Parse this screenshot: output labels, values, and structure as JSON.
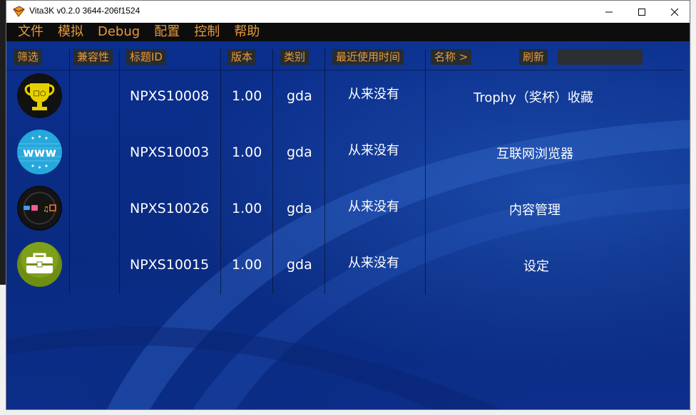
{
  "window": {
    "title": "Vita3K v0.2.0 3644-206f1524",
    "controls": {
      "minimize": "—",
      "maximize": "☐",
      "close": "✕"
    }
  },
  "menu": [
    "文件",
    "模拟",
    "Debug",
    "配置",
    "控制",
    "帮助"
  ],
  "header": {
    "filter": "筛选",
    "compat": "兼容性",
    "title_id": "标题ID",
    "version": "版本",
    "category": "类别",
    "last_used": "最近使用时间",
    "name": "名称 >",
    "refresh": "刷新",
    "search_value": ""
  },
  "apps": [
    {
      "icon": "trophy-icon",
      "title_id": "NPXS10008",
      "version": "1.00",
      "category": "gda",
      "last_used": "从来没有",
      "name": "Trophy（奖杯）收藏"
    },
    {
      "icon": "www-icon",
      "title_id": "NPXS10003",
      "version": "1.00",
      "category": "gda",
      "last_used": "从来没有",
      "name": "互联网浏览器"
    },
    {
      "icon": "media-icon",
      "title_id": "NPXS10026",
      "version": "1.00",
      "category": "gda",
      "last_used": "从来没有",
      "name": "内容管理"
    },
    {
      "icon": "toolbox-icon",
      "title_id": "NPXS10015",
      "version": "1.00",
      "category": "gda",
      "last_used": "从来没有",
      "name": "设定"
    }
  ],
  "colors": {
    "accent": "#e89a3c",
    "background": "#0b2f8e",
    "menubar": "#0d0d0d"
  }
}
